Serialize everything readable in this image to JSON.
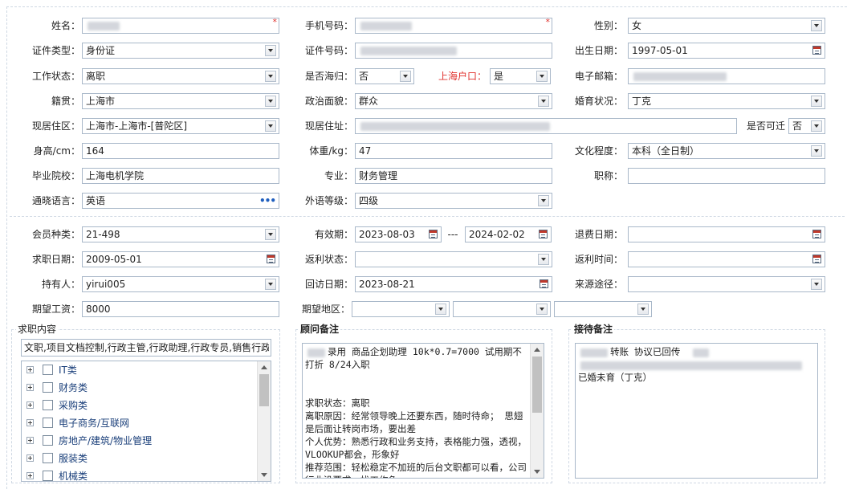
{
  "form": {
    "name": {
      "label": "姓名：",
      "required_mark": "*"
    },
    "phone": {
      "label": "手机号码：",
      "required_mark": "*"
    },
    "gender": {
      "label": "性别：",
      "value": "女"
    },
    "id_type": {
      "label": "证件类型：",
      "value": "身份证"
    },
    "id_number": {
      "label": "证件号码："
    },
    "birth_date": {
      "label": "出生日期：",
      "value": "1997-05-01"
    },
    "work_status": {
      "label": "工作状态：",
      "value": "离职"
    },
    "overseas_returnee": {
      "label": "是否海归：",
      "value": "否"
    },
    "shanghai_hukou": {
      "label": "上海户口：",
      "value": "是"
    },
    "email": {
      "label": "电子邮箱："
    },
    "native_place": {
      "label": "籍贯：",
      "value": "上海市"
    },
    "political_status": {
      "label": "政治面貌：",
      "value": "群众"
    },
    "marital_status": {
      "label": "婚育状况：",
      "value": "丁克"
    },
    "residence_area": {
      "label": "现居住区：",
      "value": "上海市-上海市-[普陀区]"
    },
    "residence_address": {
      "label": "现居住址："
    },
    "relocatable": {
      "label": "是否可迁",
      "value": "否"
    },
    "height": {
      "label": "身高/cm：",
      "value": "164"
    },
    "weight": {
      "label": "体重/kg：",
      "value": "47"
    },
    "education": {
      "label": "文化程度：",
      "value": "本科（全日制）"
    },
    "school": {
      "label": "毕业院校：",
      "value": "上海电机学院"
    },
    "major": {
      "label": "专业：",
      "value": "财务管理"
    },
    "job_title": {
      "label": "职称："
    },
    "languages": {
      "label": "通晓语言：",
      "value": "英语"
    },
    "foreign_level": {
      "label": "外语等级：",
      "value": "四级"
    }
  },
  "membership": {
    "member_type": {
      "label": "会员种类：",
      "value": "21-498"
    },
    "validity": {
      "label": "有效期：",
      "start": "2023-08-03",
      "separator": "----",
      "end": "2024-02-02"
    },
    "refund_date": {
      "label": "退费日期："
    },
    "job_seek_date": {
      "label": "求职日期：",
      "value": "2009-05-01"
    },
    "rebate_status": {
      "label": "返利状态："
    },
    "rebate_time": {
      "label": "返利时间："
    },
    "holder": {
      "label": "持有人：",
      "value": "yirui005"
    },
    "revisit_date": {
      "label": "回访日期：",
      "value": "2023-08-21"
    },
    "source": {
      "label": "来源途径："
    },
    "expected_salary": {
      "label": "期望工资：",
      "value": "8000"
    },
    "expected_area": {
      "label": "期望地区："
    }
  },
  "job_content": {
    "title": "求职内容",
    "summary": "文职,项目文档控制,行政主管,行政助理,行政专员,销售行政",
    "tree": [
      "IT类",
      "财务类",
      "采购类",
      "电子商务/互联网",
      "房地产/建筑/物业管理",
      "服装类",
      "机械类"
    ]
  },
  "consultant_notes": {
    "title": "顾问备注",
    "text": "录用 商品企划助理 10k*0.7=7000 试用期不打折 8/24入职\n\n\n求职状态：离职\n离职原因：经常领导晚上还要东西，随时待命； 思翅是后面让转岗市场，要出差\n个人优势：熟悉行政和业务支持，表格能力强，透视，VLOOKUP都会，形象好\n推荐范围：轻松稳定不加班的后台文职都可以看，公司行业没要求，找工作急"
  },
  "reception_notes": {
    "title": "接待备注",
    "text": "转账 协议已回传\n\n已婚未育（丁克）"
  }
}
